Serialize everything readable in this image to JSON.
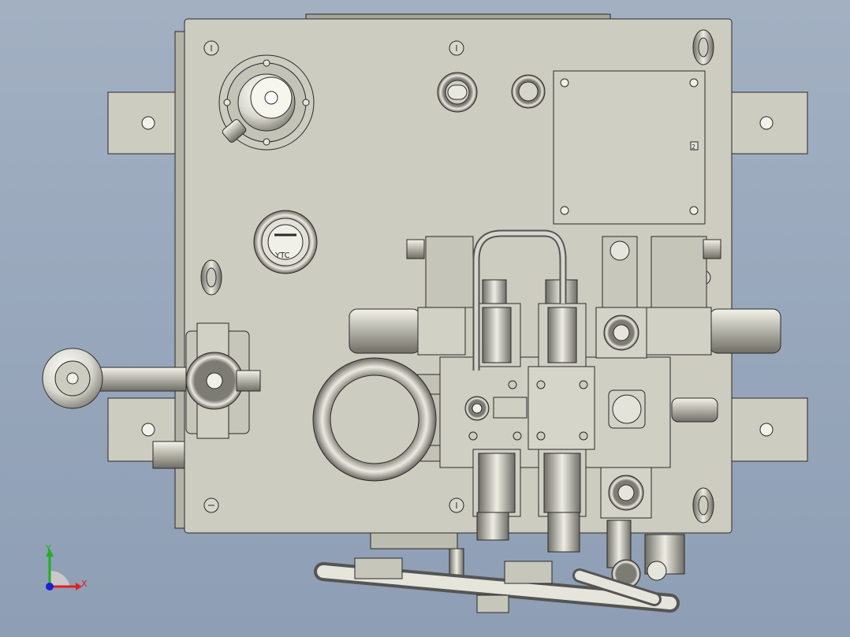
{
  "colors": {
    "background": "#98a7bb",
    "plate": "#cdccc0",
    "outline": "#2a2a2a",
    "axis_x": "#e02020",
    "axis_y": "#20b020",
    "axis_z": "#2020d0"
  },
  "triad": {
    "x_label": "X",
    "y_label": "Y"
  },
  "gauge_text": "YTC",
  "plate_marking": "2"
}
